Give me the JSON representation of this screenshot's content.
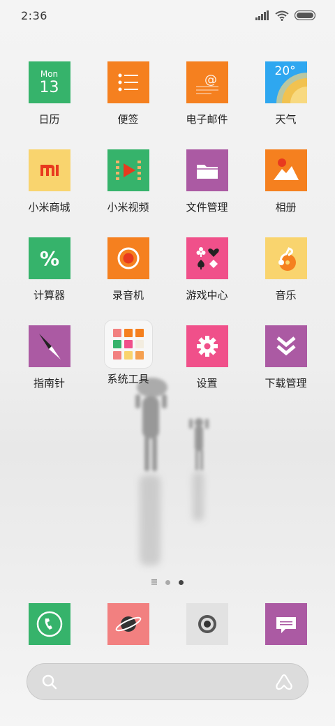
{
  "status_bar": {
    "time": "2:36"
  },
  "calendar_icon": {
    "day": "Mon",
    "date": "13"
  },
  "weather_icon": {
    "temp": "20°"
  },
  "apps": [
    {
      "label": "日历",
      "icon": "calendar-icon",
      "color": "#36b36b"
    },
    {
      "label": "便签",
      "icon": "notes-icon",
      "color": "#f5801f"
    },
    {
      "label": "电子邮件",
      "icon": "email-icon",
      "color": "#f5801f"
    },
    {
      "label": "天气",
      "icon": "weather-icon",
      "color": "#2ea7f0"
    },
    {
      "label": "小米商城",
      "icon": "mi-store-icon",
      "color": "#f9d46e"
    },
    {
      "label": "小米视频",
      "icon": "video-icon",
      "color": "#36b36b"
    },
    {
      "label": "文件管理",
      "icon": "folder-icon",
      "color": "#ab5aa3"
    },
    {
      "label": "相册",
      "icon": "gallery-icon",
      "color": "#f5801f"
    },
    {
      "label": "计算器",
      "icon": "calculator-icon",
      "color": "#36b36b"
    },
    {
      "label": "录音机",
      "icon": "recorder-icon",
      "color": "#f5801f"
    },
    {
      "label": "游戏中心",
      "icon": "game-center-icon",
      "color": "#f0508a"
    },
    {
      "label": "音乐",
      "icon": "music-icon",
      "color": "#f9d46e"
    },
    {
      "label": "指南针",
      "icon": "compass-icon",
      "color": "#ab5aa3"
    },
    {
      "label": "系统工具",
      "icon": "system-tools-folder-icon",
      "color": "#f7f7f7"
    },
    {
      "label": "设置",
      "icon": "settings-icon",
      "color": "#f0508a"
    },
    {
      "label": "下载管理",
      "icon": "downloads-icon",
      "color": "#ab5aa3"
    }
  ],
  "dock": [
    {
      "icon": "phone-icon",
      "color": "#36b36b"
    },
    {
      "icon": "browser-icon",
      "color": "#f28080"
    },
    {
      "icon": "camera-icon",
      "color": "#e2e2e2"
    },
    {
      "icon": "messages-icon",
      "color": "#ab5aa3"
    }
  ],
  "search_bar": {
    "left_icon": "search-icon",
    "right_icon": "assistant-icon"
  }
}
